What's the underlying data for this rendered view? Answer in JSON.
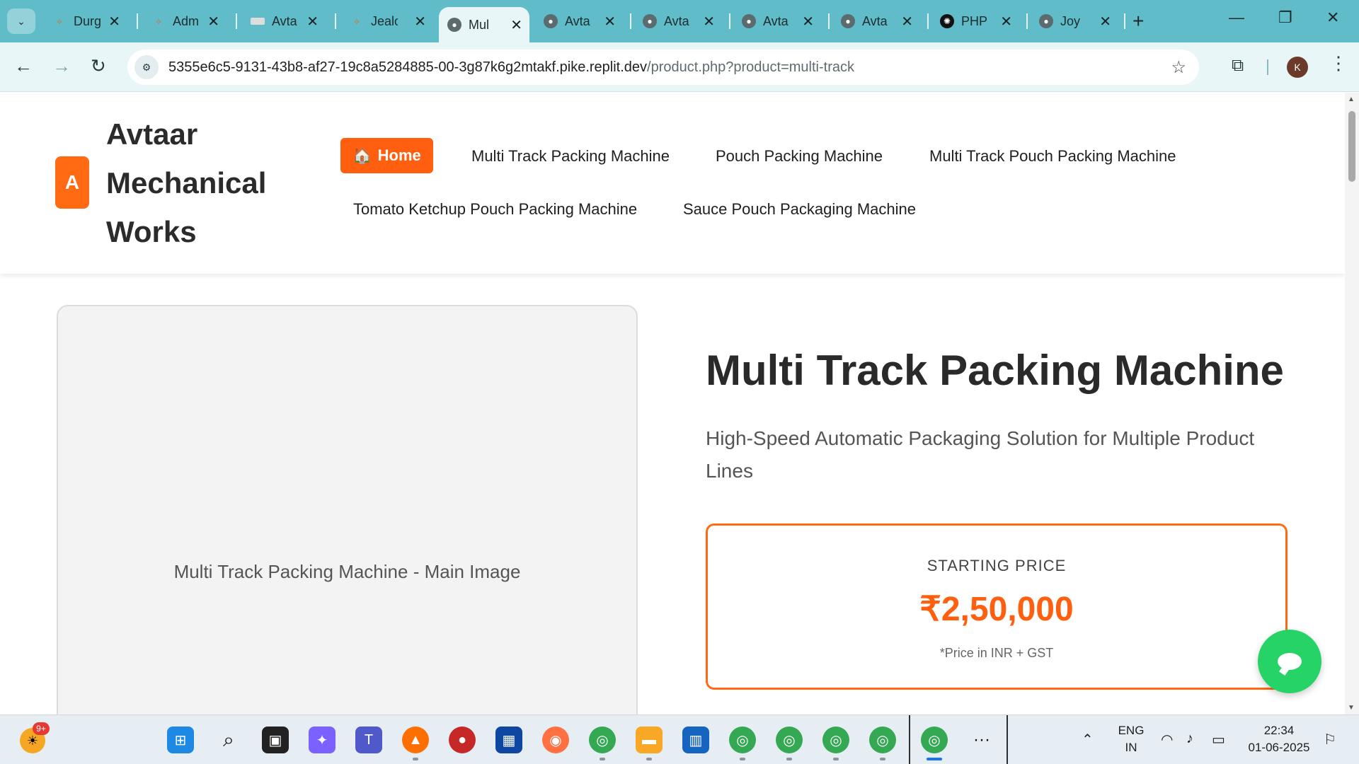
{
  "browser": {
    "tabs": [
      {
        "title": "Durg",
        "favicon": "replit-icon",
        "active": false
      },
      {
        "title": "Adm",
        "favicon": "replit-icon",
        "active": false
      },
      {
        "title": "Avta",
        "favicon": "page-icon",
        "active": false
      },
      {
        "title": "Jealo",
        "favicon": "replit-icon",
        "active": false
      },
      {
        "title": "Mul",
        "favicon": "globe-icon",
        "active": true
      },
      {
        "title": "Avta",
        "favicon": "globe-icon",
        "active": false
      },
      {
        "title": "Avta",
        "favicon": "globe-icon",
        "active": false
      },
      {
        "title": "Avta",
        "favicon": "globe-icon",
        "active": false
      },
      {
        "title": "Avta",
        "favicon": "globe-icon",
        "active": false
      },
      {
        "title": "PHP",
        "favicon": "openai-icon",
        "active": false
      },
      {
        "title": "Joy",
        "favicon": "globe-icon",
        "active": false
      }
    ],
    "url_host": "5355e6c5-9131-43b8-af27-19c8a5284885-00-3g87k6g2mtakf.pike.replit.dev",
    "url_path": "/product.php?product=multi-track",
    "profile_initial": "K"
  },
  "site": {
    "logo_letter": "A",
    "brand_name": "Avtaar Mechanical Works",
    "nav": {
      "home_icon": "🏠",
      "home": "Home",
      "links": [
        "Multi Track Packing Machine",
        "Pouch Packing Machine",
        "Multi Track Pouch Packing Machine",
        "Tomato Ketchup Pouch Packing Machine",
        "Sauce Pouch Packaging Machine"
      ]
    }
  },
  "product": {
    "image_caption": "Multi Track Packing Machine - Main Image",
    "title": "Multi Track Packing Machine",
    "subtitle": "High-Speed Automatic Packaging Solution for Multiple Product Lines",
    "price_label": "STARTING PRICE",
    "price_value": "₹2,50,000",
    "price_note": "*Price in INR + GST"
  },
  "taskbar": {
    "notification_badge": "9+",
    "language": "ENG",
    "region": "IN",
    "time": "22:34",
    "date": "01-06-2025",
    "overflow_label": "···"
  },
  "colors": {
    "accent": "#ff6a13",
    "chrome": "#5fbcc8",
    "chat": "#25d366"
  }
}
